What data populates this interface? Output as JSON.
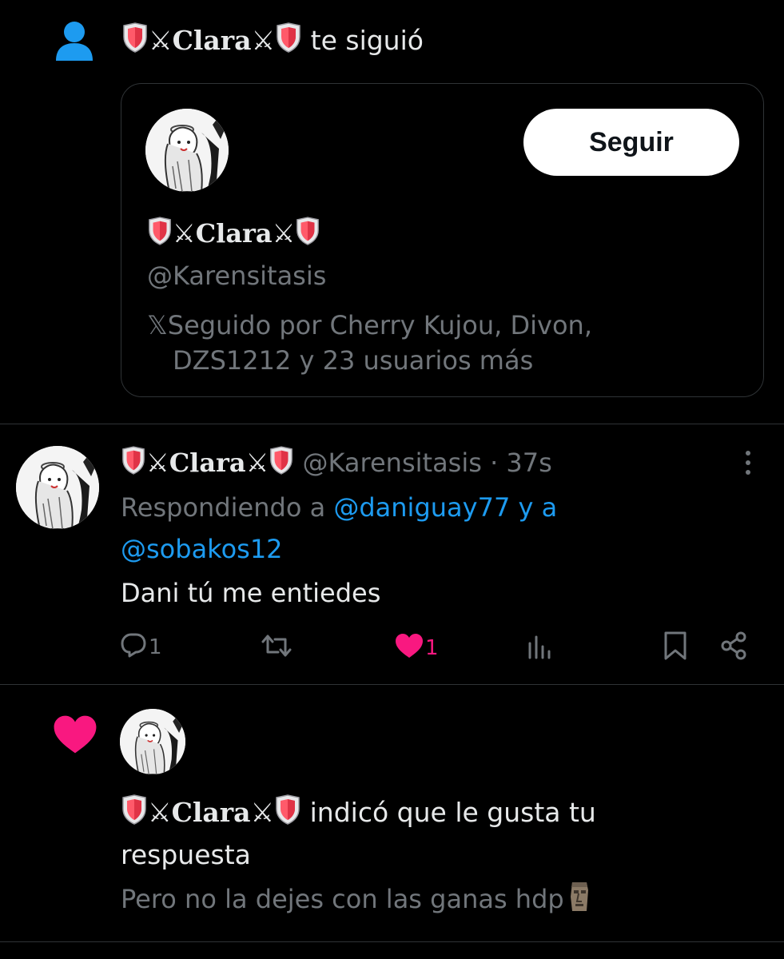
{
  "follow_notification": {
    "display_name": "Clara",
    "action_text": "te siguió",
    "card": {
      "follow_button": "Seguir",
      "display_name": "Clara",
      "handle": "@Karensitasis",
      "followed_by_line1": "𝕏Seguido por Cherry Kujou, Divon,",
      "followed_by_line2": "DZS1212 y 23 usuarios más"
    }
  },
  "reply": {
    "display_name": "Clara",
    "handle": "@Karensitasis",
    "time": "· 37s",
    "replying_prefix": "Respondiendo a",
    "mention1": "@daniguay77",
    "mention_joiner": "y a",
    "mention2": "@sobakos12",
    "text": "Dani tú me entiedes",
    "actions": {
      "reply_count": "1",
      "like_count": "1"
    }
  },
  "like_notification": {
    "display_name": "Clara",
    "action_line1": "indicó que le gusta tu",
    "action_line2": "respuesta",
    "quoted_text": "Pero no la dejes con las ganas hdp"
  },
  "colors": {
    "accent_blue": "#1d9bf0",
    "like_pink": "#f91880",
    "muted": "#71767b"
  }
}
